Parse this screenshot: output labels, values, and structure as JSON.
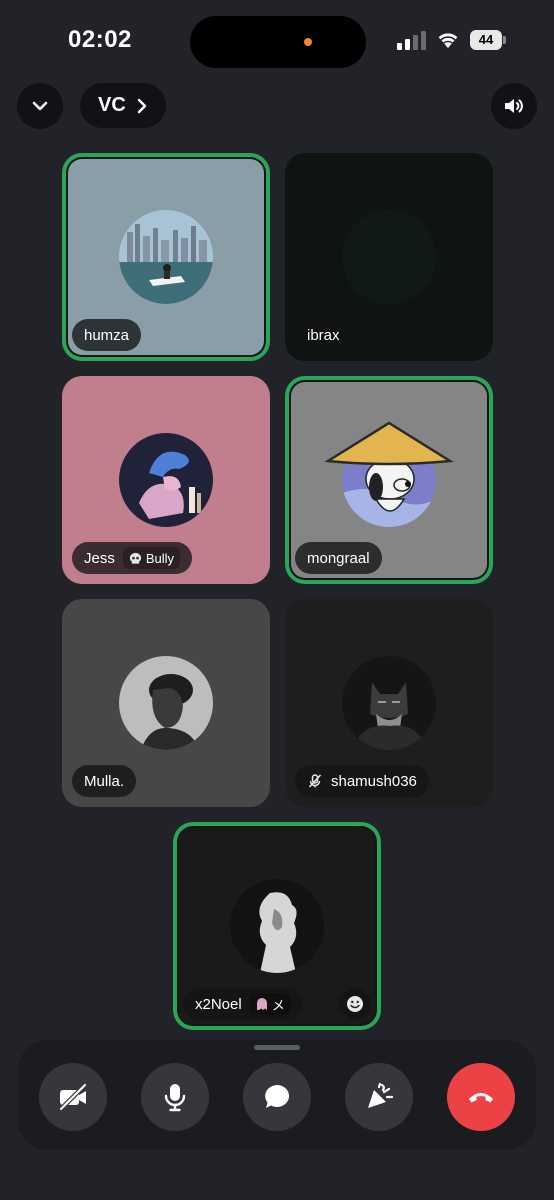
{
  "status_bar": {
    "time": "02:02",
    "battery": "44"
  },
  "header": {
    "channel_name": "VC"
  },
  "participants": [
    {
      "name": "humza",
      "speaking": true
    },
    {
      "name": "ibrax",
      "speaking": false
    },
    {
      "name": "Jess",
      "badge": "Bully",
      "speaking": false
    },
    {
      "name": "mongraal",
      "speaking": true
    },
    {
      "name": "Mulla.",
      "speaking": false
    },
    {
      "name": "shamush036",
      "muted": true,
      "speaking": false
    },
    {
      "name": "x2Noel",
      "badge": "メ",
      "speaking": true
    }
  ],
  "colors": {
    "background": "#222329",
    "speaking_ring": "#2aa559",
    "end_call": "#ed4245",
    "control_button": "#35373d"
  },
  "controls": [
    "camera-off-icon",
    "microphone-icon",
    "chat-icon",
    "activities-icon",
    "end-call-icon"
  ]
}
